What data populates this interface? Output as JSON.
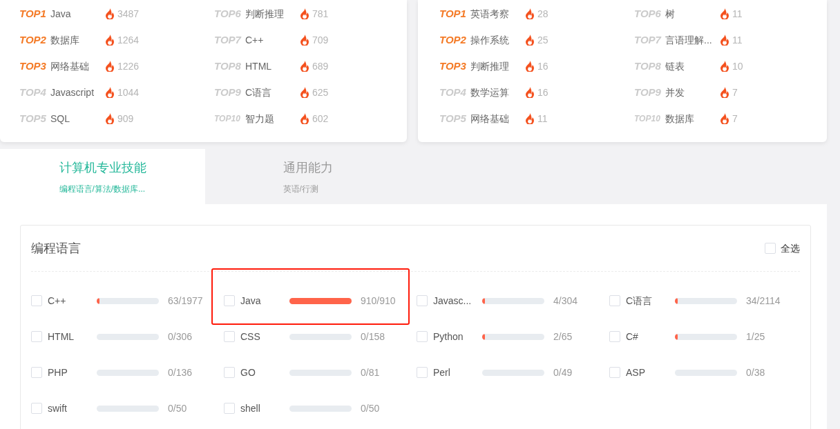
{
  "hot_lists": [
    {
      "items": [
        {
          "rank": "TOP1",
          "top": true,
          "name": "Java",
          "count": "3487"
        },
        {
          "rank": "TOP2",
          "top": true,
          "name": "数据库",
          "count": "1264"
        },
        {
          "rank": "TOP3",
          "top": true,
          "name": "网络基础",
          "count": "1226"
        },
        {
          "rank": "TOP4",
          "top": false,
          "name": "Javascript",
          "count": "1044"
        },
        {
          "rank": "TOP5",
          "top": false,
          "name": "SQL",
          "count": "909"
        },
        {
          "rank": "TOP6",
          "top": false,
          "name": "判断推理",
          "count": "781"
        },
        {
          "rank": "TOP7",
          "top": false,
          "name": "C++",
          "count": "709"
        },
        {
          "rank": "TOP8",
          "top": false,
          "name": "HTML",
          "count": "689"
        },
        {
          "rank": "TOP9",
          "top": false,
          "name": "C语言",
          "count": "625"
        },
        {
          "rank": "TOP10",
          "top": false,
          "name": "智力题",
          "count": "602"
        }
      ]
    },
    {
      "items": [
        {
          "rank": "TOP1",
          "top": true,
          "name": "英语考察",
          "count": "28"
        },
        {
          "rank": "TOP2",
          "top": true,
          "name": "操作系统",
          "count": "25"
        },
        {
          "rank": "TOP3",
          "top": true,
          "name": "判断推理",
          "count": "16"
        },
        {
          "rank": "TOP4",
          "top": false,
          "name": "数学运算",
          "count": "16"
        },
        {
          "rank": "TOP5",
          "top": false,
          "name": "网络基础",
          "count": "11"
        },
        {
          "rank": "TOP6",
          "top": false,
          "name": "树",
          "count": "11"
        },
        {
          "rank": "TOP7",
          "top": false,
          "name": "言语理解...",
          "count": "11"
        },
        {
          "rank": "TOP8",
          "top": false,
          "name": "链表",
          "count": "10"
        },
        {
          "rank": "TOP9",
          "top": false,
          "name": "并发",
          "count": "7"
        },
        {
          "rank": "TOP10",
          "top": false,
          "name": "数据库",
          "count": "7"
        }
      ]
    }
  ],
  "tabs": [
    {
      "title": "计算机专业技能",
      "subtitle": "编程语言/算法/数据库...",
      "selected": true
    },
    {
      "title": "通用能力",
      "subtitle": "英语/行测",
      "selected": false
    }
  ],
  "section": {
    "title": "编程语言",
    "select_all": {
      "label": "全选",
      "checked": false
    },
    "skills": [
      {
        "name": "C++",
        "checked": false,
        "level": 0.032,
        "reading": "63/1977",
        "highlighted": false
      },
      {
        "name": "Java",
        "checked": false,
        "level": 1,
        "reading": "910/910",
        "highlighted": true
      },
      {
        "name": "Javasc...",
        "checked": false,
        "level": 0.013,
        "reading": "4/304",
        "highlighted": false
      },
      {
        "name": "C语言",
        "checked": false,
        "level": 0.016,
        "reading": "34/2114",
        "highlighted": false
      },
      {
        "name": "HTML",
        "checked": false,
        "level": 0,
        "reading": "0/306",
        "highlighted": false
      },
      {
        "name": "CSS",
        "checked": false,
        "level": 0,
        "reading": "0/158",
        "highlighted": false
      },
      {
        "name": "Python",
        "checked": false,
        "level": 0.031,
        "reading": "2/65",
        "highlighted": false
      },
      {
        "name": "C#",
        "checked": false,
        "level": 0.04,
        "reading": "1/25",
        "highlighted": false
      },
      {
        "name": "PHP",
        "checked": false,
        "level": 0,
        "reading": "0/136",
        "highlighted": false
      },
      {
        "name": "GO",
        "checked": false,
        "level": 0,
        "reading": "0/81",
        "highlighted": false
      },
      {
        "name": "Perl",
        "checked": false,
        "level": 0,
        "reading": "0/49",
        "highlighted": false
      },
      {
        "name": "ASP",
        "checked": false,
        "level": 0,
        "reading": "0/38",
        "highlighted": false
      },
      {
        "name": "swift",
        "checked": false,
        "level": 0,
        "reading": "0/50",
        "highlighted": false
      },
      {
        "name": "shell",
        "checked": false,
        "level": 0,
        "reading": "0/50",
        "highlighted": false
      }
    ]
  }
}
